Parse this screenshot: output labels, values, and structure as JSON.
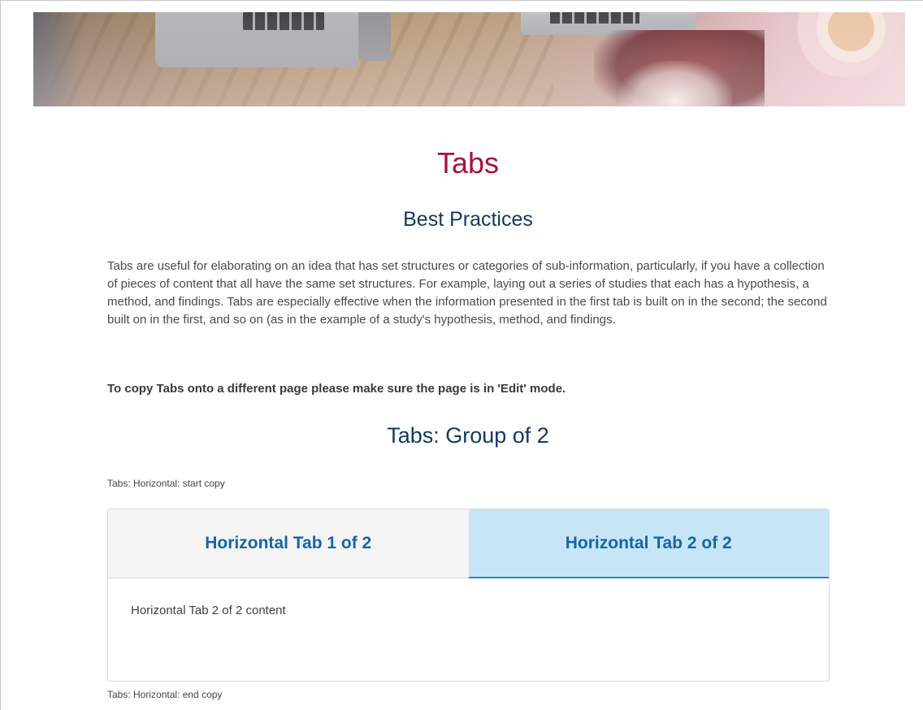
{
  "page": {
    "title": "Tabs",
    "subtitle": "Best Practices",
    "intro": "Tabs are useful for elaborating on an idea that has set structures or categories of sub-information, particularly, if you have a collection of pieces of content that all have the same set structures. For example, laying out a series of studies that each has a hypothesis, a method, and findings. Tabs are especially effective when the information presented in the first tab is built on in the second; the second built on in the first, and so on (as in the example of a study's hypothesis, method, and findings.",
    "copy_note": "To copy Tabs onto a different page please make sure the page is in 'Edit' mode.",
    "group_title": "Tabs: Group of 2",
    "start_copy": "Tabs: Horizontal: start copy",
    "end_copy": "Tabs: Horizontal: end copy"
  },
  "tabs": {
    "items": [
      {
        "label": "Horizontal Tab 1 of 2",
        "active": false
      },
      {
        "label": "Horizontal Tab 2 of 2",
        "active": true
      }
    ],
    "active_content": "Horizontal Tab 2 of 2 content"
  },
  "colors": {
    "title": "#a6123c",
    "heading": "#12395e",
    "tab_text": "#1565a8",
    "active_tab_bg": "#c6e6f7",
    "inactive_tab_bg": "#f5f5f5"
  }
}
